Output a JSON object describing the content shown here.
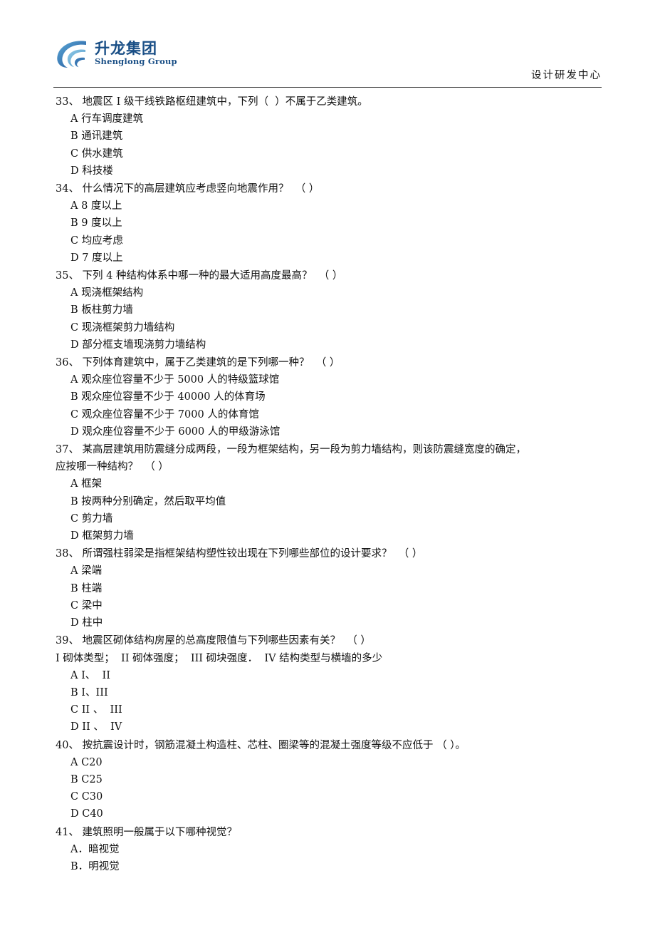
{
  "header": {
    "logo_cn": "升龙集团",
    "logo_en": "Shenglong Group",
    "logo_color": "#1a4f86",
    "right_text": "设计研发中心"
  },
  "questions": [
    {
      "number": "33、",
      "stem": "地震区 I 级干线铁路枢纽建筑中，下列（  ）不属于乙类建筑。",
      "stem_line2": "",
      "sub": "",
      "options": [
        "A 行车调度建筑",
        "B 通讯建筑",
        "C 供水建筑",
        "D 科技楼"
      ]
    },
    {
      "number": "34、",
      "stem": "什么情况下的高层建筑应考虑竖向地震作用？  （ ）",
      "stem_line2": "",
      "sub": "",
      "options": [
        "A 8 度以上",
        "B 9 度以上",
        "C 均应考虑",
        "D 7 度以上"
      ]
    },
    {
      "number": "35、",
      "stem": "下列 4 种结构体系中哪一种的最大适用高度最高？  （ ）",
      "stem_line2": "",
      "sub": "",
      "options": [
        "A 现浇框架结构",
        "B 板柱剪力墙",
        "C 现浇框架剪力墙结构",
        "D 部分框支墙现浇剪力墙结构"
      ]
    },
    {
      "number": "36、",
      "stem": "下列体育建筑中，属于乙类建筑的是下列哪一种？  （ ）",
      "stem_line2": "",
      "sub": "",
      "options": [
        "A 观众座位容量不少于 5000 人的特级篮球馆",
        "B 观众座位容量不少于 40000 人的体育场",
        "C 观众座位容量不少于 7000 人的体育馆",
        "D 观众座位容量不少于 6000 人的甲级游泳馆"
      ]
    },
    {
      "number": "37、",
      "stem": "某高层建筑用防震缝分成两段，一段为框架结构，另一段为剪力墙结构，则该防震缝宽度的确定，",
      "stem_line2": "应按哪一种结构？  （ ）",
      "sub": "",
      "options": [
        "A 框架",
        "B 按两种分别确定，然后取平均值",
        "C 剪力墙",
        "D 框架剪力墙"
      ]
    },
    {
      "number": "38、",
      "stem": "所谓强柱弱梁是指框架结构塑性铰出现在下列哪些部位的设计要求？  （ ）",
      "stem_line2": "",
      "sub": "",
      "options": [
        "A 梁端",
        "B 柱端",
        "C 梁中",
        "D 柱中"
      ]
    },
    {
      "number": "39、",
      "stem": "地震区砌体结构房屋的总高度限值与下列哪些因素有关？  （ ）",
      "stem_line2": "",
      "sub": "I 砌体类型；  II 砌体强度；  III 砌块强度．  IV 结构类型与横墙的多少",
      "options": [
        "A I、  II",
        "B I、III",
        "C II 、  III",
        "D II 、  IV"
      ]
    },
    {
      "number": "40、",
      "stem": "按抗震设计时，钢筋混凝土构造柱、芯柱、圈梁等的混凝土强度等级不应低于 （ ）。",
      "stem_line2": "",
      "sub": "",
      "options": [
        "A C20",
        "B C25",
        "C C30",
        "D C40"
      ]
    },
    {
      "number": "41、",
      "stem": "建筑照明一般属于以下哪种视觉？",
      "stem_line2": "",
      "sub": "",
      "options": [
        "A．暗视觉",
        "B．明视觉"
      ]
    }
  ]
}
